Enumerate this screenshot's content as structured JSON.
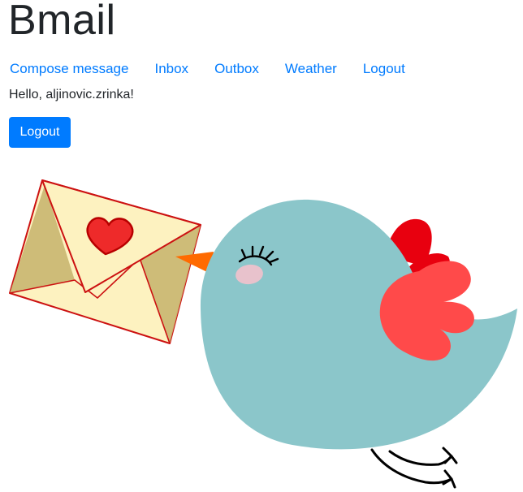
{
  "app": {
    "title": "Bmail"
  },
  "nav": {
    "items": [
      {
        "label": "Compose message"
      },
      {
        "label": "Inbox"
      },
      {
        "label": "Outbox"
      },
      {
        "label": "Weather"
      },
      {
        "label": "Logout"
      }
    ]
  },
  "main": {
    "greeting": "Hello, aljinovic.zrinka!",
    "logout_button_label": "Logout"
  },
  "colors": {
    "link": "#007bff",
    "primary_button": "#007bff",
    "envelope_fill": "#fdf2c0",
    "envelope_outline": "#cc1111",
    "heart": "#ee2a2a",
    "bird_body": "#8bc6ca",
    "bird_wing": "#ff4a4a",
    "bird_crest": "#e8000f",
    "bird_beak": "#ff6a00"
  },
  "illustration": {
    "icon": "bird-carrying-love-letter"
  }
}
